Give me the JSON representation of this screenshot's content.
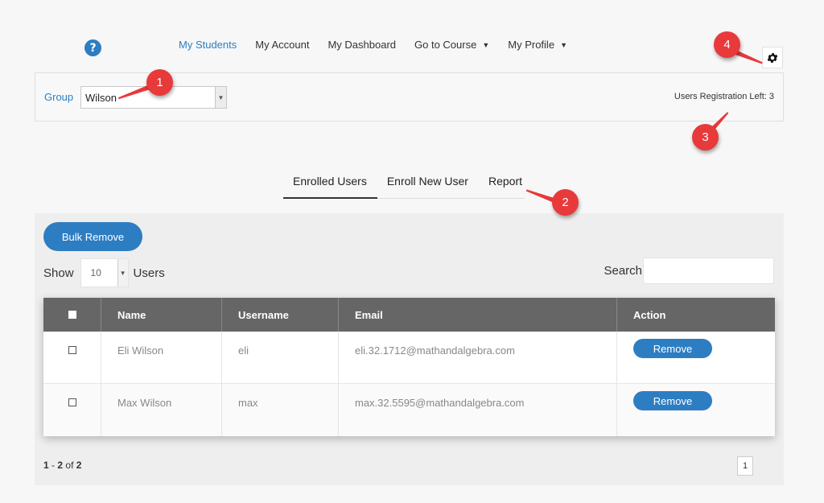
{
  "nav": {
    "items": [
      {
        "label": "My Students",
        "active": true,
        "dropdown": false
      },
      {
        "label": "My Account",
        "active": false,
        "dropdown": false
      },
      {
        "label": "My Dashboard",
        "active": false,
        "dropdown": false
      },
      {
        "label": "Go to Course",
        "active": false,
        "dropdown": true
      },
      {
        "label": "My Profile",
        "active": false,
        "dropdown": true
      }
    ],
    "help_icon": "question-circle-icon",
    "help_glyph": "?",
    "settings_icon": "gear-icon"
  },
  "group": {
    "label": "Group",
    "selected": "Wilson",
    "registration_left": "Users Registration Left: 3"
  },
  "tabs": [
    {
      "label": "Enrolled Users",
      "active": true
    },
    {
      "label": "Enroll New User",
      "active": false
    },
    {
      "label": "Report",
      "active": false
    }
  ],
  "toolbar": {
    "bulk_remove_label": "Bulk Remove",
    "show_label": "Show",
    "show_value": "10",
    "users_label": "Users",
    "search_label": "Search",
    "search_value": ""
  },
  "table": {
    "headers": [
      "Name",
      "Username",
      "Email",
      "Action"
    ],
    "rows": [
      {
        "name": "Eli Wilson",
        "username": "eli",
        "email": "eli.32.1712@mathandalgebra.com",
        "action": "Remove"
      },
      {
        "name": "Max Wilson",
        "username": "max",
        "email": "max.32.5595@mathandalgebra.com",
        "action": "Remove"
      }
    ]
  },
  "pagination": {
    "range_start": "1",
    "range_end": "2",
    "of_label": "of",
    "total": "2",
    "current_page": "1"
  },
  "annotations": [
    "1",
    "2",
    "3",
    "4"
  ],
  "colors": {
    "accent": "#2d7dc2",
    "marker": "#e8393b",
    "table_header": "#666666"
  }
}
